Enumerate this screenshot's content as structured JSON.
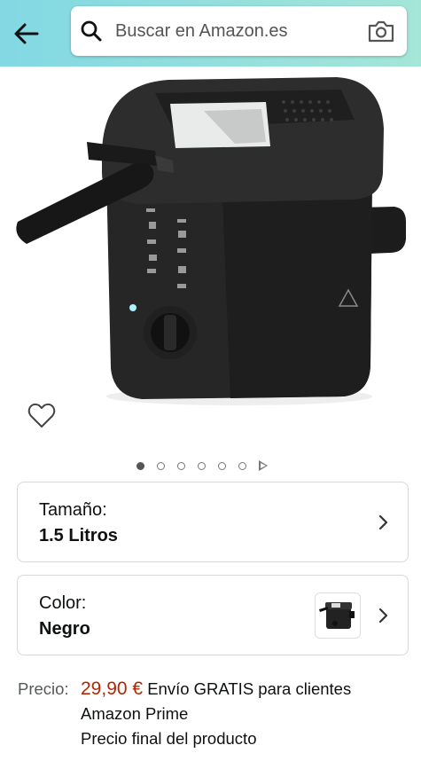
{
  "search": {
    "placeholder": "Buscar en Amazon.es"
  },
  "icons": {
    "back": "arrow-left-icon",
    "search": "search-icon",
    "camera": "camera-icon",
    "wishlist": "heart-icon",
    "chevron": "chevron-right-icon"
  },
  "gallery": {
    "total_images": 6,
    "active_index": 0
  },
  "options": {
    "size": {
      "label": "Tamaño:",
      "value": "1.5 Litros"
    },
    "color": {
      "label": "Color:",
      "value": "Negro"
    }
  },
  "pricing": {
    "label": "Precio:",
    "price": "29,90 €",
    "shipping_a": "Envío GRATIS para clientes",
    "shipping_b": "Amazon Prime",
    "final_note": "Precio final del producto"
  },
  "colors": {
    "price": "#b12704",
    "header_start": "#82d8e3",
    "header_end": "#a4e6d8"
  }
}
